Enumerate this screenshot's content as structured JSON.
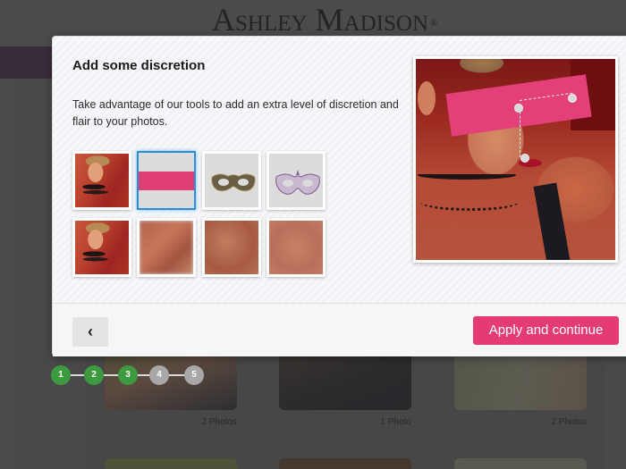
{
  "header": {
    "logo_text": "Ashley Madison",
    "logo_mark": "®"
  },
  "background": {
    "photo_counts": [
      "2 Photos",
      "1 Photo",
      "2 Photos"
    ]
  },
  "steps": {
    "items": [
      {
        "label": "1",
        "status": "done"
      },
      {
        "label": "2",
        "status": "done"
      },
      {
        "label": "3",
        "status": "done"
      },
      {
        "label": "4",
        "status": "todo"
      },
      {
        "label": "5",
        "status": "todo"
      }
    ],
    "current": 3
  },
  "modal": {
    "title": "Add some discretion",
    "description": "Take advantage of our tools to add an extra level of discretion and flair to your photos.",
    "tools": [
      {
        "name": "original",
        "icon": "portrait-thumbnail",
        "selected": false
      },
      {
        "name": "pink-bar",
        "icon": "censor-bar-icon",
        "selected": true
      },
      {
        "name": "gold-mask",
        "icon": "masquerade-mask-icon",
        "selected": false
      },
      {
        "name": "silver-mask",
        "icon": "masquerade-mask-icon",
        "selected": false
      },
      {
        "name": "original-2",
        "icon": "portrait-thumbnail",
        "selected": false
      },
      {
        "name": "blur-light",
        "icon": "blur-thumbnail",
        "selected": false
      },
      {
        "name": "blur-medium",
        "icon": "blur-thumbnail",
        "selected": false
      },
      {
        "name": "blur-heavy",
        "icon": "blur-thumbnail",
        "selected": false
      }
    ],
    "preview": {
      "overlay": "pink-bar"
    },
    "footer": {
      "back_label": "‹",
      "apply_label": "Apply and continue"
    }
  },
  "colors": {
    "accent_pink": "#e33b72",
    "step_done": "#3e9a3e",
    "step_todo": "#a8a8a8",
    "selected_border": "#2a8ed8"
  }
}
